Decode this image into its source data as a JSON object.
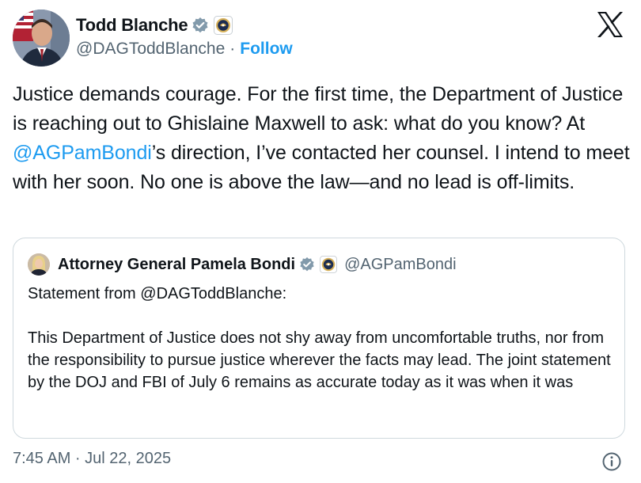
{
  "author": {
    "name": "Todd Blanche",
    "handle": "@DAGToddBlanche",
    "separator": "·",
    "follow_label": "Follow",
    "verified_badge_icon": "verified-badge-icon",
    "affiliation_icon": "doj-seal-icon"
  },
  "tweet": {
    "text_part1": "Justice demands courage. For the first time, the Department of Justice is reaching out to Ghislaine Maxwell to ask: what do you know? At ",
    "mention": "@AGPamBondi",
    "text_part2": "’s direction, I’ve contacted her counsel. I intend to meet with her soon. No one is above the law—and no lead is off-limits."
  },
  "quoted": {
    "name": "Attorney General Pamela Bondi",
    "handle": "@AGPamBondi",
    "text": "Statement from @DAGToddBlanche:\n\nThis Department of Justice does not shy away from uncomfortable truths, nor from the responsibility to pursue justice wherever the facts may lead.  The joint statement by the DOJ and FBI of July 6 remains as accurate today as it was when it was"
  },
  "footer": {
    "timestamp": "7:45 AM · Jul 22, 2025",
    "info_icon": "info-icon"
  },
  "colors": {
    "accent": "#1d9bf0",
    "text": "#0f1419",
    "secondary": "#536471",
    "border": "#cfd9de"
  }
}
